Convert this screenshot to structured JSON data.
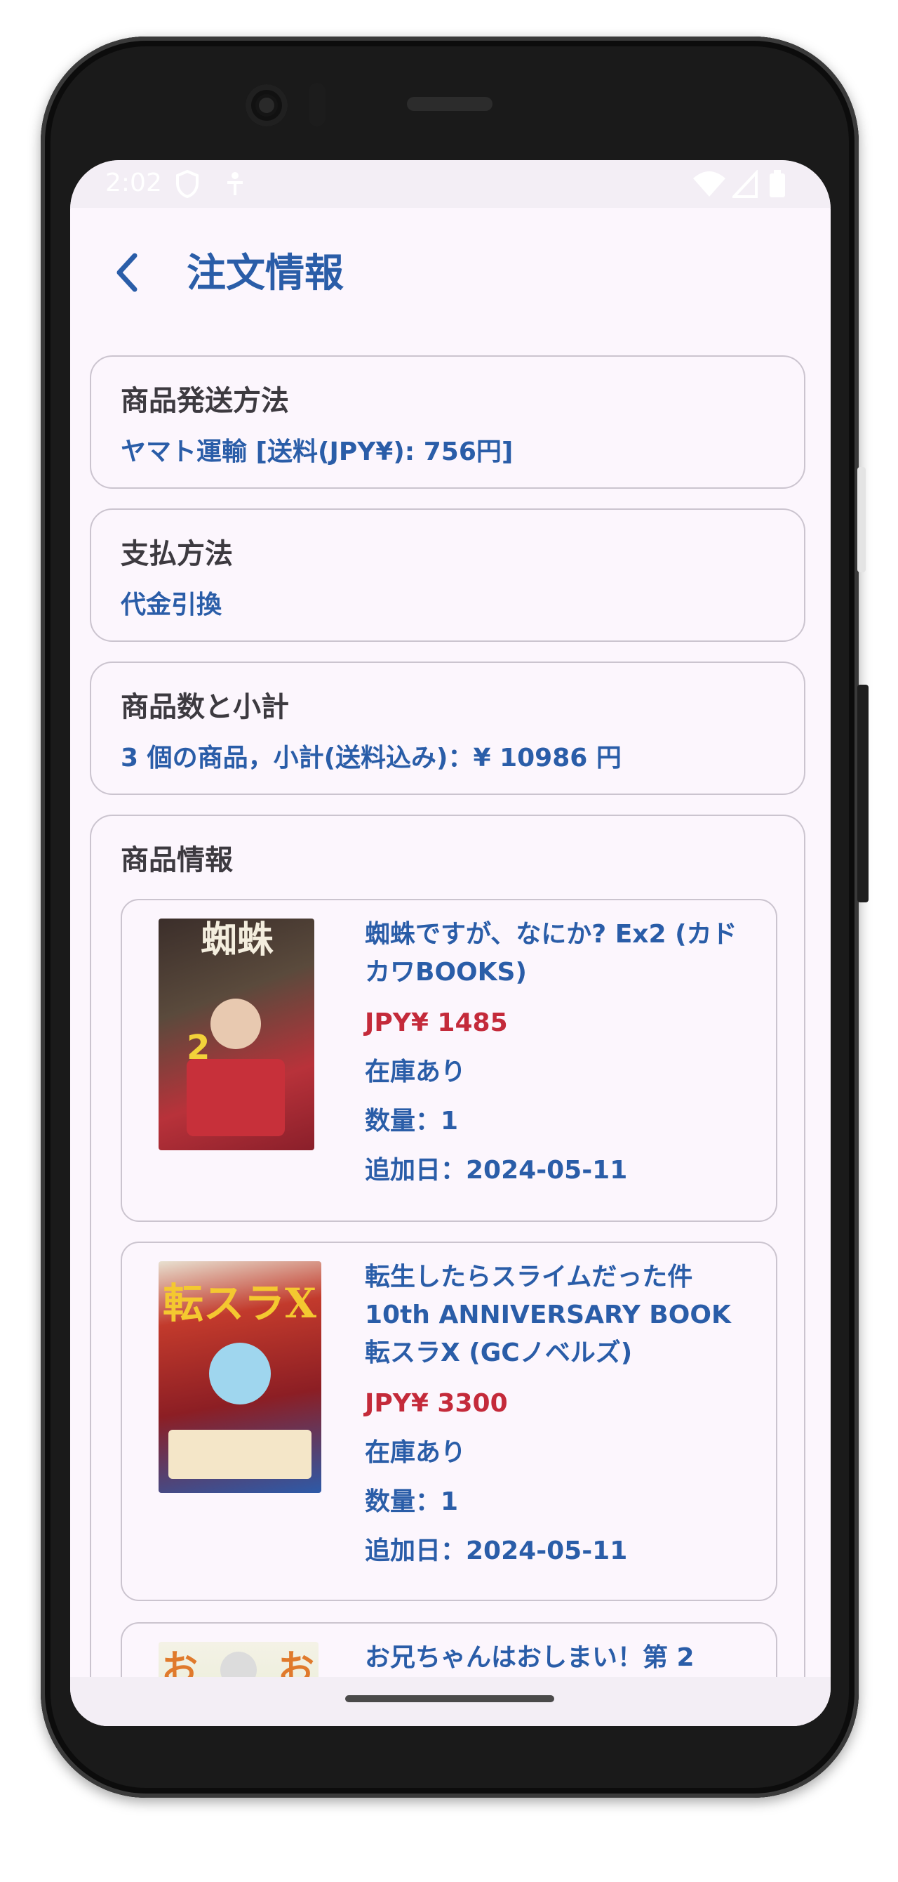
{
  "status_bar": {
    "time": "2:02",
    "icons": [
      "shield-icon",
      "accessibility-icon",
      "wifi-icon",
      "signal-icon",
      "battery-icon"
    ]
  },
  "app_bar": {
    "back_icon": "chevron-left-icon",
    "title": "注文情報"
  },
  "shipping": {
    "title": "商品発送方法",
    "value": "ヤマト運輸 [送料(JPY¥): 756円]"
  },
  "payment": {
    "title": "支払方法",
    "value": "代金引換"
  },
  "summary": {
    "title": "商品数と小計",
    "value": "3 個の商品，小計(送料込み)：¥ 10986 円"
  },
  "products": {
    "title": "商品情報",
    "items": [
      {
        "name": "蜘蛛ですが、なにか? Ex2 (カドカワBOOKS)",
        "price": "JPY¥ 1485",
        "stock": "在庫あり",
        "quantity": "数量：1",
        "added": "追加日：2024-05-11"
      },
      {
        "name": "転生したらスライムだった件 10th ANNIVERSARY BOOK 転スラX (GCノベルズ)",
        "price": "JPY¥ 3300",
        "stock": "在庫あり",
        "quantity": "数量：1",
        "added": "追加日：2024-05-11"
      },
      {
        "name": "お兄ちゃんはおしまい！第 2"
      }
    ]
  },
  "colors": {
    "accent": "#2a5da8",
    "price": "#c42a3a",
    "background": "#fcf6fd",
    "border": "#cbc4cf"
  }
}
